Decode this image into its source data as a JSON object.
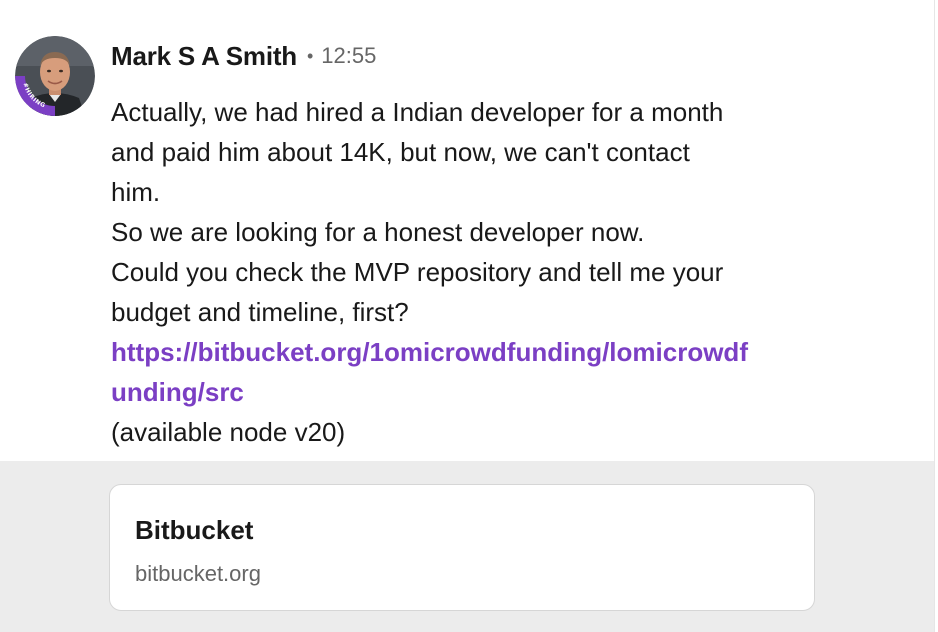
{
  "message": {
    "sender_name": "Mark S A Smith",
    "separator": "•",
    "timestamp": "12:55",
    "avatar": {
      "badge_text": "#HIRING",
      "badge_color": "#7b3fc4"
    },
    "body_lines": [
      "Actually, we had hired a Indian developer for a month",
      "and paid him about 14K, but now, we can't contact",
      "him.",
      "So we are looking for a honest developer now.",
      "Could you check the MVP repository and tell me your",
      "budget and timeline, first?"
    ],
    "link_lines": [
      "https://bitbucket.org/1omicrowdfunding/lomicrowdf",
      "unding/src"
    ],
    "footer_line": "(available node v20)"
  },
  "link_preview": {
    "title": "Bitbucket",
    "domain": "bitbucket.org"
  },
  "colors": {
    "link": "#7b3fc4",
    "text": "#191919",
    "muted": "#666666",
    "preview_background": "#ececec"
  }
}
